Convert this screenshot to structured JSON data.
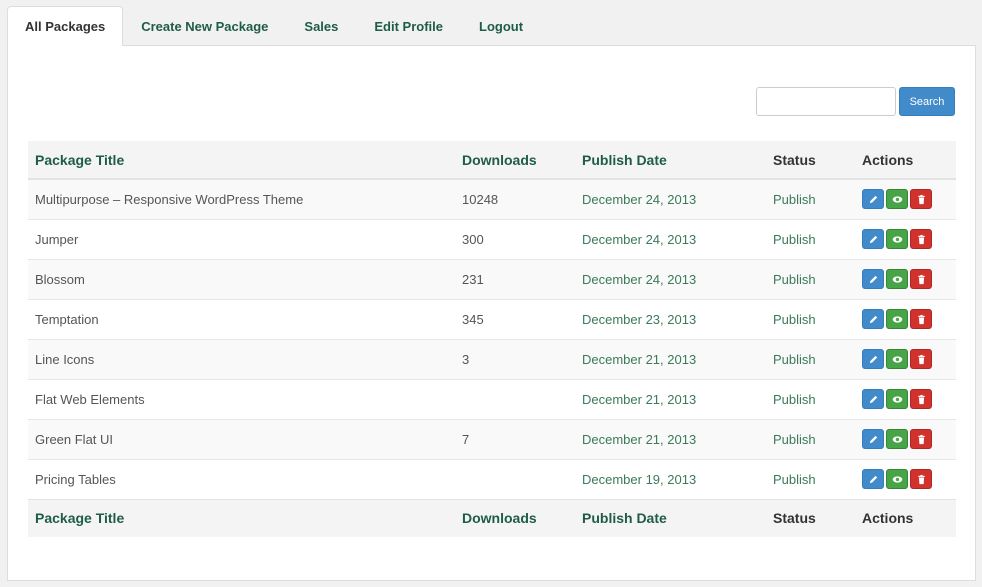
{
  "tabs": [
    {
      "label": "All Packages",
      "active": true
    },
    {
      "label": "Create New Package",
      "active": false
    },
    {
      "label": "Sales",
      "active": false
    },
    {
      "label": "Edit Profile",
      "active": false
    },
    {
      "label": "Logout",
      "active": false
    }
  ],
  "search": {
    "value": "",
    "placeholder": "",
    "button_label": "Search"
  },
  "table": {
    "headers": {
      "title": "Package Title",
      "downloads": "Downloads",
      "date": "Publish Date",
      "status": "Status",
      "actions": "Actions"
    },
    "rows": [
      {
        "title": "Multipurpose – Responsive WordPress Theme",
        "downloads": "10248",
        "date": "December 24, 2013",
        "status": "Publish"
      },
      {
        "title": "Jumper",
        "downloads": "300",
        "date": "December 24, 2013",
        "status": "Publish"
      },
      {
        "title": "Blossom",
        "downloads": "231",
        "date": "December 24, 2013",
        "status": "Publish"
      },
      {
        "title": "Temptation",
        "downloads": "345",
        "date": "December 23, 2013",
        "status": "Publish"
      },
      {
        "title": "Line Icons",
        "downloads": "3",
        "date": "December 21, 2013",
        "status": "Publish"
      },
      {
        "title": "Flat Web Elements",
        "downloads": "",
        "date": "December 21, 2013",
        "status": "Publish"
      },
      {
        "title": "Green Flat UI",
        "downloads": "7",
        "date": "December 21, 2013",
        "status": "Publish"
      },
      {
        "title": "Pricing Tables",
        "downloads": "",
        "date": "December 19, 2013",
        "status": "Publish"
      }
    ],
    "action_icons": [
      "pencil-icon",
      "eye-icon",
      "trash-icon"
    ]
  },
  "colors": {
    "edit": "#428bca",
    "view": "#47a447",
    "delete": "#d2322d",
    "accent_text": "#1f5c48"
  }
}
